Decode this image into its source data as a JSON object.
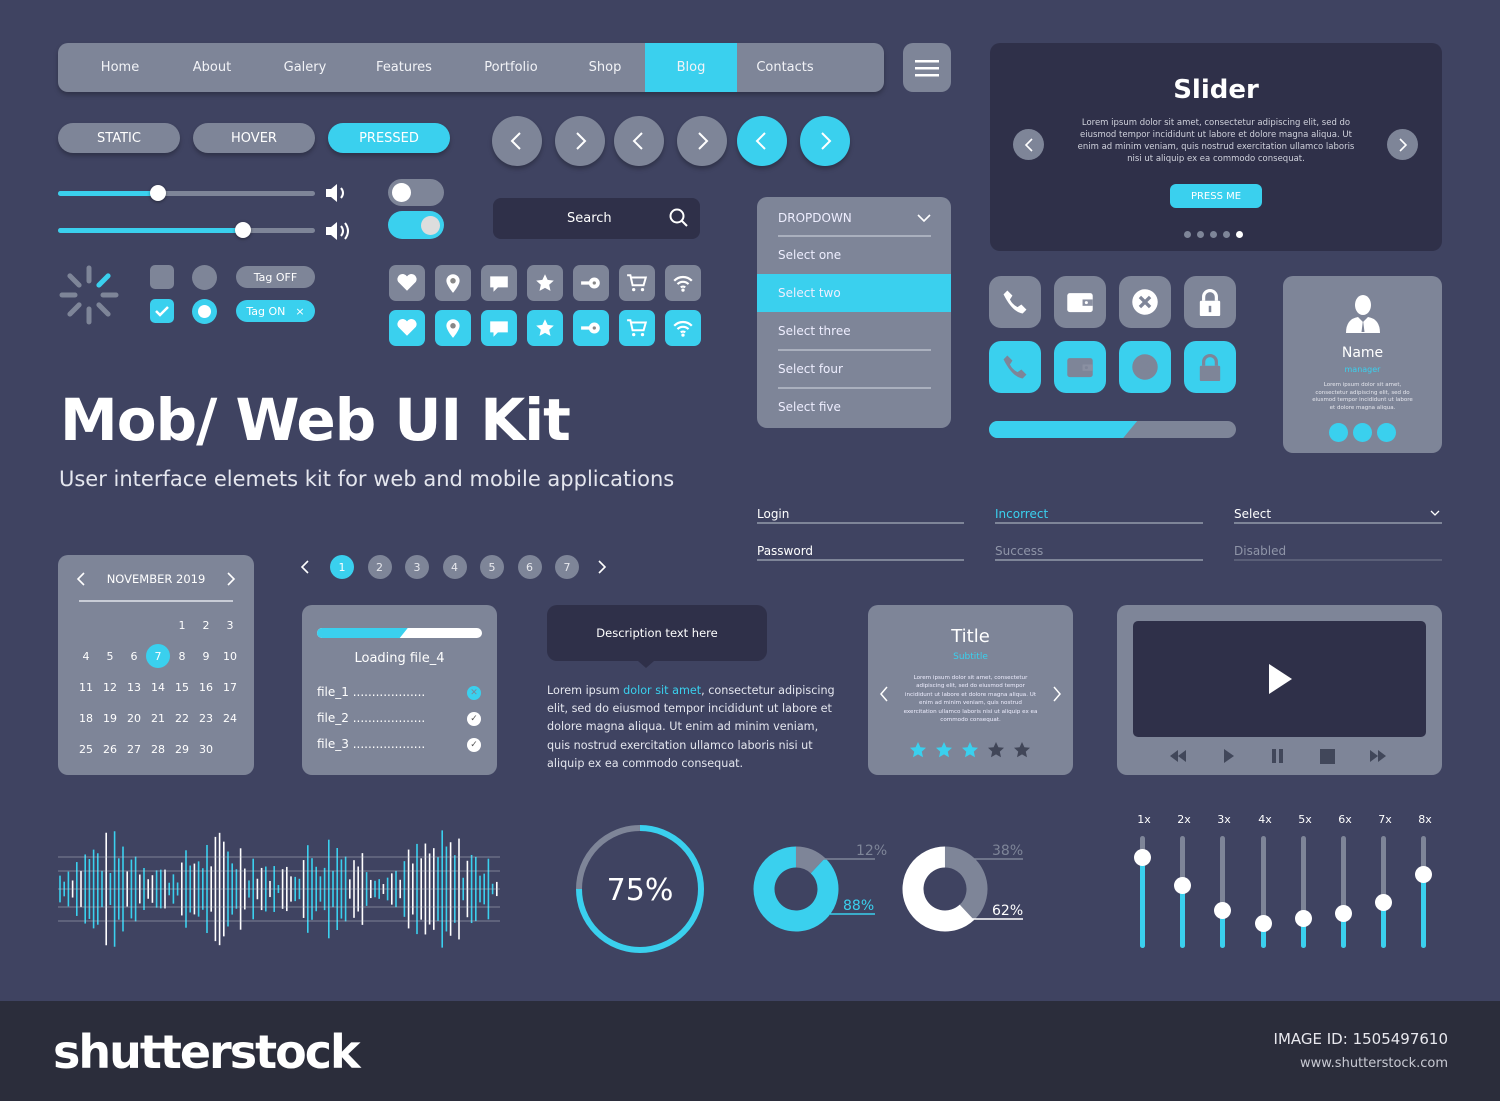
{
  "colors": {
    "background": "#3f4361",
    "panel": "#7e8598",
    "dark": "#2f3049",
    "accent": "#3ad0ee",
    "footer": "#2b2d3b"
  },
  "nav": {
    "items": [
      "Home",
      "About",
      "Galery",
      "Features",
      "Portfolio",
      "Shop",
      "Blog",
      "Contacts"
    ],
    "active": "Blog",
    "menu_icon": "hamburger-icon"
  },
  "buttons": {
    "static": "STATIC",
    "hover": "HOVER",
    "pressed": "PRESSED"
  },
  "arrows": [
    "chevron-left-icon",
    "chevron-right-icon",
    "chevron-left-icon",
    "chevron-right-icon",
    "chevron-left-icon",
    "chevron-right-icon"
  ],
  "volume_sliders": [
    {
      "value": 0.39,
      "icon": "volume-low-icon"
    },
    {
      "value": 0.72,
      "icon": "volume-high-icon"
    }
  ],
  "toggles": [
    {
      "on": false
    },
    {
      "on": true
    }
  ],
  "search": {
    "placeholder": "Search",
    "icon": "search-icon"
  },
  "tags": {
    "off": "Tag OFF",
    "on": "Tag ON",
    "remove": "×"
  },
  "icons": [
    "heart-icon",
    "map-pin-icon",
    "chat-icon",
    "star-icon",
    "key-icon",
    "cart-icon",
    "wifi-icon"
  ],
  "dropdown": {
    "label": "DROPDOWN",
    "items": [
      "Select one",
      "Select two",
      "Select three",
      "Select four",
      "Select five"
    ],
    "selected": "Select two"
  },
  "hero": {
    "title": "Mob/ Web UI Kit",
    "subtitle": "User interface elemets kit for web and mobile applications"
  },
  "slider_card": {
    "title": "Slider",
    "text": "Lorem ipsum dolor sit amet, consectetur adipiscing elit, sed do eiusmod tempor incididunt ut labore et dolore magna aliqua. Ut enim ad minim veniam, quis nostrud exercitation ullamco laboris nisi ut aliquip ex ea commodo consequat.",
    "button": "PRESS ME",
    "pages": 5,
    "active_page": 5
  },
  "action_icons": [
    "phone-icon",
    "wallet-icon",
    "close-circle-icon",
    "lock-icon"
  ],
  "progress": {
    "value": 0.6
  },
  "profile": {
    "name": "Name",
    "role": "manager",
    "text": "Lorem ipsum dolor sit amet, consectetur adipiscing elit, sed do eiusmod tempor incididunt ut labore et dolore magna aliqua."
  },
  "forms": {
    "login": "Login",
    "password": "Password",
    "incorrect": "Incorrect",
    "success": "Success",
    "select": "Select",
    "disabled": "Disabled"
  },
  "calendar": {
    "month": "NOVEMBER 2019",
    "first_weekday": 4,
    "days": 30,
    "selected": 7
  },
  "pagination": {
    "pages": [
      "1",
      "2",
      "3",
      "4",
      "5",
      "6",
      "7"
    ],
    "active": "1"
  },
  "loading": {
    "value": 0.55,
    "label": "Loading file_4",
    "files": [
      {
        "name": "file_1",
        "dots": "...................",
        "status": "error"
      },
      {
        "name": "file_2",
        "dots": "...................",
        "status": "done"
      },
      {
        "name": "file_3",
        "dots": "...................",
        "status": "done"
      }
    ]
  },
  "tooltip": {
    "text": "Description text here"
  },
  "paragraph": {
    "before": "Lorem ipsum ",
    "link": "dolor sit amet",
    "after": ", consectetur adipiscing elit, sed do eiusmod tempor incididunt ut labore et dolore magna aliqua. Ut enim ad minim veniam, quis nostrud exercitation ullamco laboris nisi ut aliquip ex ea commodo consequat."
  },
  "rating_card": {
    "title": "Title",
    "subtitle": "Subtitle",
    "text": "Lorem ipsum dolor sit amet, consectetur adipiscing elit, sed do eiusmod tempor incididunt ut labore et dolore magna aliqua. Ut enim ad minim veniam, quis nostrud exercitation ullamco laboris nisi ut aliquip ex ea commodo consequat.",
    "rating": 3,
    "max": 5
  },
  "video": {
    "controls": [
      "rewind-icon",
      "play-icon",
      "pause-icon",
      "stop-icon",
      "fast-forward-icon"
    ]
  },
  "chart_data": [
    {
      "type": "pie",
      "title": "",
      "values": [
        75,
        25
      ],
      "label": "75%"
    },
    {
      "type": "pie",
      "values": [
        88,
        12
      ],
      "labels": [
        "88%",
        "12%"
      ]
    },
    {
      "type": "pie",
      "values": [
        62,
        38
      ],
      "labels": [
        "62%",
        "38%"
      ]
    },
    {
      "type": "bar",
      "categories": [
        "1x",
        "2x",
        "3x",
        "4x",
        "5x",
        "6x",
        "7x",
        "8x"
      ],
      "values": [
        0.8,
        0.55,
        0.33,
        0.21,
        0.26,
        0.3,
        0.4,
        0.65
      ],
      "ylim": [
        0,
        1
      ]
    }
  ],
  "footer": {
    "logo": "shutterstock",
    "image_id_label": "IMAGE ID:",
    "image_id": "1505497610",
    "url": "www.shutterstock.com"
  }
}
